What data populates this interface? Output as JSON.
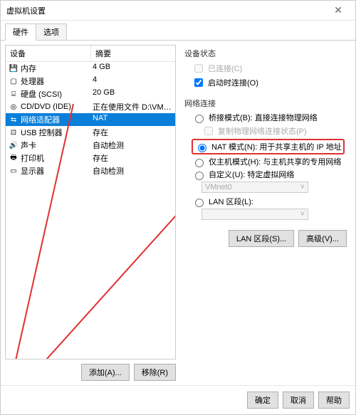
{
  "window": {
    "title": "虚拟机设置"
  },
  "tabs": {
    "hardware": "硬件",
    "options": "选项"
  },
  "list": {
    "header": {
      "device": "设备",
      "summary": "摘要"
    },
    "rows": [
      {
        "icon": "💾",
        "name": "内存",
        "summary": "4 GB"
      },
      {
        "icon": "▢",
        "name": "处理器",
        "summary": "4"
      },
      {
        "icon": "⌸",
        "name": "硬盘 (SCSI)",
        "summary": "20 GB"
      },
      {
        "icon": "◎",
        "name": "CD/DVD (IDE)",
        "summary": "正在使用文件 D:\\VMware\\Ce..."
      },
      {
        "icon": "⇆",
        "name": "网络适配器",
        "summary": "NAT"
      },
      {
        "icon": "⊡",
        "name": "USB 控制器",
        "summary": "存在"
      },
      {
        "icon": "🔊",
        "name": "声卡",
        "summary": "自动检测"
      },
      {
        "icon": "🖶",
        "name": "打印机",
        "summary": "存在"
      },
      {
        "icon": "▭",
        "name": "显示器",
        "summary": "自动检测"
      }
    ]
  },
  "left_buttons": {
    "add": "添加(A)...",
    "remove": "移除(R)"
  },
  "right": {
    "status_label": "设备状态",
    "connected": "已连接(C)",
    "connect_on": "启动时连接(O)",
    "netconn_label": "网络连接",
    "bridged": "桥接模式(B): 直接连接物理网络",
    "replicate": "复制物理网络连接状态(P)",
    "nat": "NAT 模式(N): 用于共享主机的 IP 地址",
    "hostonly": "仅主机模式(H): 与主机共享的专用网络",
    "custom": "自定义(U): 特定虚拟网络",
    "vmnet": "VMnet0",
    "lanseg": "LAN 区段(L):",
    "btn_lan": "LAN 区段(S)...",
    "btn_adv": "高级(V)..."
  },
  "footer": {
    "ok": "确定",
    "cancel": "取消",
    "help": "帮助"
  }
}
